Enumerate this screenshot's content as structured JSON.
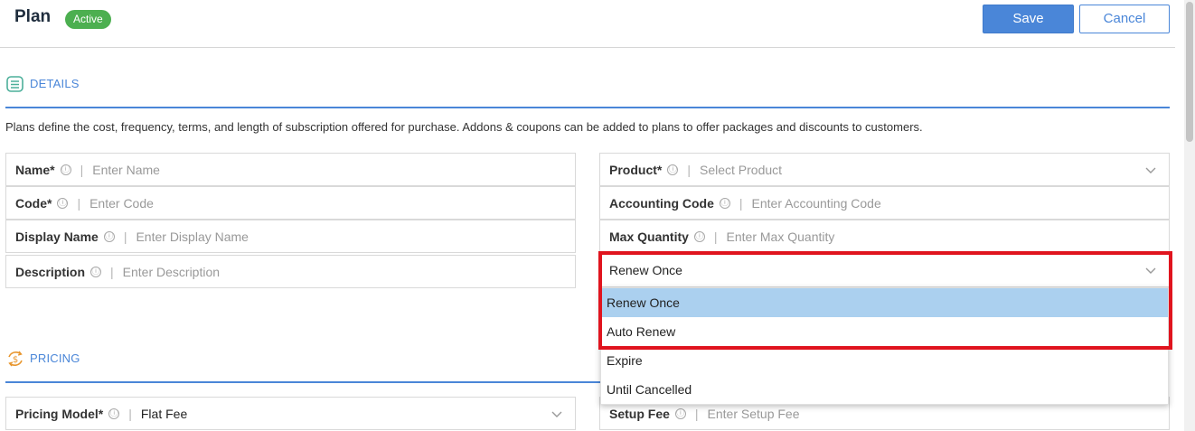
{
  "header": {
    "title": "Plan",
    "status_badge": "Active",
    "save_label": "Save",
    "cancel_label": "Cancel"
  },
  "details": {
    "section_label": "DETAILS",
    "description": "Plans define the cost, frequency, terms, and length of subscription offered for purchase. Addons & coupons can be added to plans to offer packages and discounts to customers.",
    "left_fields": [
      {
        "label": "Name*",
        "placeholder": "Enter Name"
      },
      {
        "label": "Code*",
        "placeholder": "Enter Code"
      },
      {
        "label": "Display Name",
        "placeholder": "Enter Display Name"
      },
      {
        "label": "Description",
        "placeholder": "Enter Description"
      }
    ],
    "right_fields": [
      {
        "label": "Product*",
        "placeholder": "Select Product"
      },
      {
        "label": "Accounting Code",
        "placeholder": "Enter Accounting Code"
      },
      {
        "label": "Max Quantity",
        "placeholder": "Enter Max Quantity"
      }
    ],
    "renewal_select": {
      "selected": "Renew Once",
      "options": [
        "Renew Once",
        "Auto Renew",
        "Expire",
        "Until Cancelled"
      ]
    }
  },
  "pricing": {
    "section_label": "PRICING",
    "pricing_model": {
      "label": "Pricing Model*",
      "value": "Flat Fee"
    },
    "setup_fee": {
      "label": "Setup Fee",
      "placeholder": "Enter Setup Fee"
    }
  },
  "colors": {
    "accent": "#4a86d8",
    "badge_green": "#4caf50",
    "highlight_red": "#e0141e",
    "selected_option": "#abd0ef"
  },
  "info_glyph": "ⓘ"
}
